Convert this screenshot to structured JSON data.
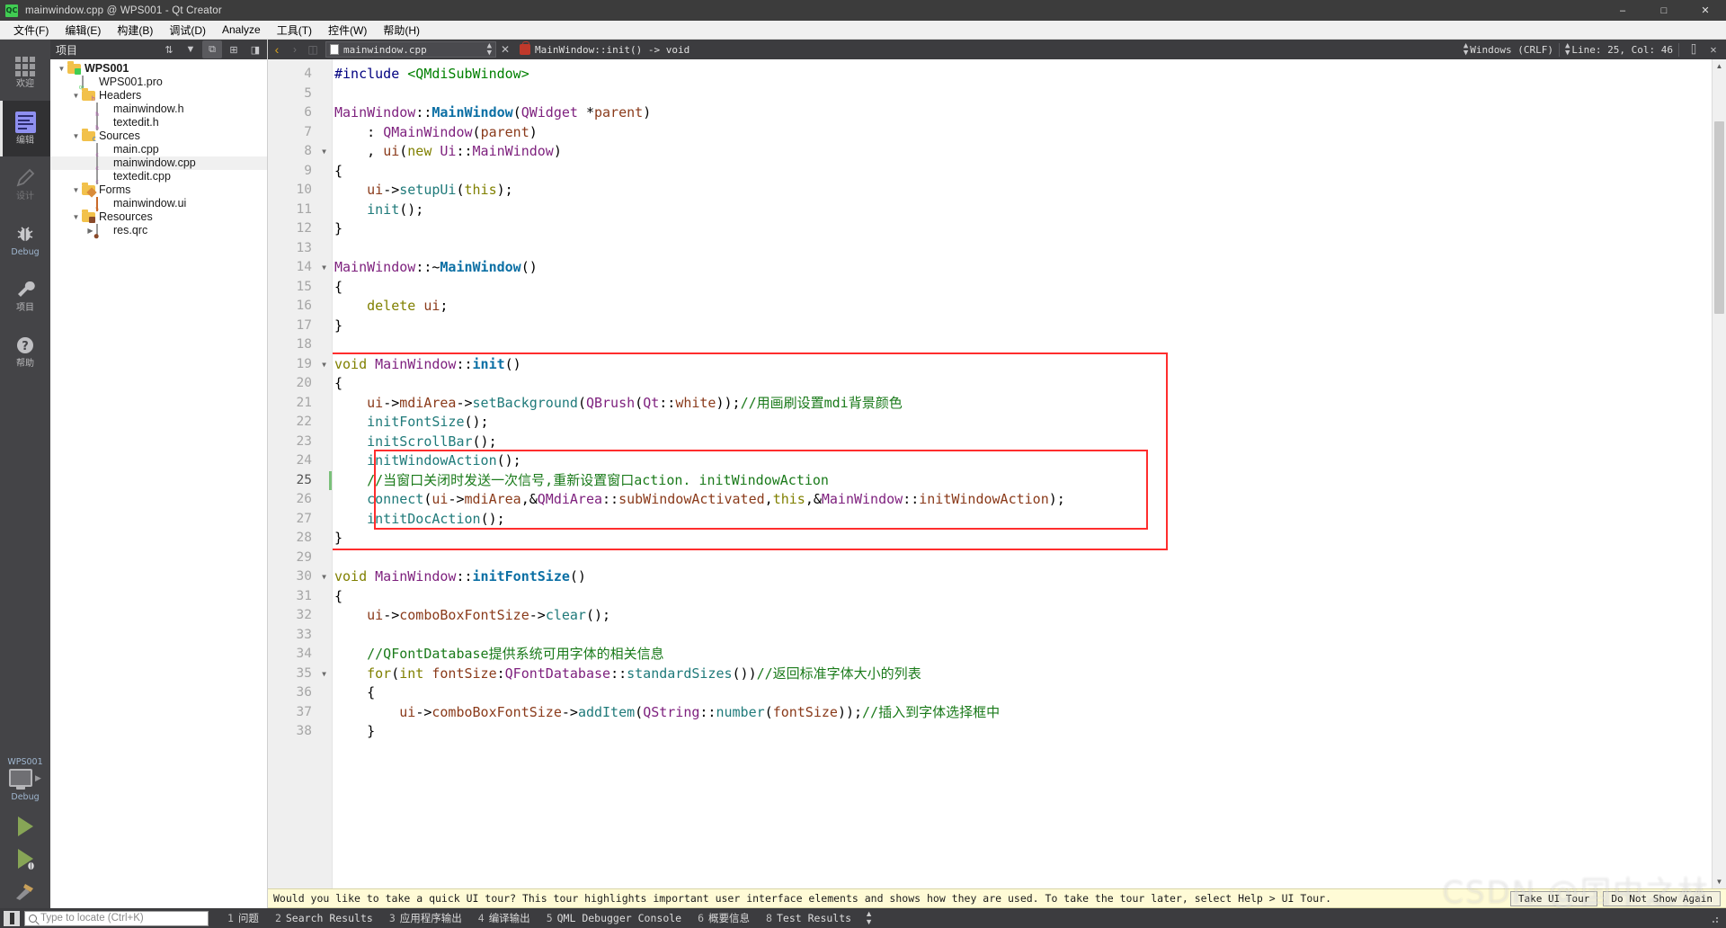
{
  "window": {
    "title": "mainwindow.cpp @ WPS001 - Qt Creator",
    "logo": "qt-creator-logo",
    "minimize": "–",
    "maximize": "□",
    "close": "✕"
  },
  "menubar": {
    "items": [
      {
        "label": "文件(F)",
        "name": "menu-file"
      },
      {
        "label": "编辑(E)",
        "name": "menu-edit"
      },
      {
        "label": "构建(B)",
        "name": "menu-build"
      },
      {
        "label": "调试(D)",
        "name": "menu-debug"
      },
      {
        "label": "Analyze",
        "name": "menu-analyze"
      },
      {
        "label": "工具(T)",
        "name": "menu-tools"
      },
      {
        "label": "控件(W)",
        "name": "menu-window"
      },
      {
        "label": "帮助(H)",
        "name": "menu-help"
      }
    ]
  },
  "activitybar": {
    "modes": [
      {
        "label": "欢迎",
        "icon": "grid-icon",
        "active": false,
        "dim": false
      },
      {
        "label": "编辑",
        "icon": "edit-icon",
        "active": true,
        "dim": false
      },
      {
        "label": "设计",
        "icon": "pencil-icon",
        "active": false,
        "dim": true
      },
      {
        "label": "Debug",
        "icon": "bug-icon",
        "active": false,
        "dim": false
      },
      {
        "label": "项目",
        "icon": "wrench-icon",
        "active": false,
        "dim": false
      },
      {
        "label": "帮助",
        "icon": "question-icon",
        "active": false,
        "dim": false
      }
    ],
    "kit": {
      "project": "WPS001",
      "build_config": "Debug",
      "run_label": "run-button",
      "debug_label": "run-debug-button",
      "build_label": "build-button"
    }
  },
  "project_panel": {
    "title": "项目",
    "toolbar": [
      {
        "name": "sort-toggle-button",
        "glyph": "⇅"
      },
      {
        "name": "filter-button",
        "glyph": "▼"
      },
      {
        "name": "sync-with-editor-button",
        "glyph": "⧉"
      },
      {
        "name": "expand-all-button",
        "glyph": "⊞"
      },
      {
        "name": "hide-sidebar-button",
        "glyph": "◨"
      }
    ],
    "tree": [
      {
        "label": "WPS001",
        "indent": 0,
        "twist": "▼",
        "icon": "project-folder-icon",
        "bold": true,
        "selected": false
      },
      {
        "label": "WPS001.pro",
        "indent": 1,
        "twist": "",
        "icon": "pro-file-icon",
        "bold": false,
        "selected": false
      },
      {
        "label": "Headers",
        "indent": 1,
        "twist": "▼",
        "icon": "headers-folder-icon",
        "bold": false,
        "selected": false
      },
      {
        "label": "mainwindow.h",
        "indent": 2,
        "twist": "",
        "icon": "header-file-icon",
        "bold": false,
        "selected": false
      },
      {
        "label": "textedit.h",
        "indent": 2,
        "twist": "",
        "icon": "header-file-icon",
        "bold": false,
        "selected": false
      },
      {
        "label": "Sources",
        "indent": 1,
        "twist": "▼",
        "icon": "sources-folder-icon",
        "bold": false,
        "selected": false
      },
      {
        "label": "main.cpp",
        "indent": 2,
        "twist": "",
        "icon": "cpp-file-icon",
        "bold": false,
        "selected": false
      },
      {
        "label": "mainwindow.cpp",
        "indent": 2,
        "twist": "",
        "icon": "cpp-file-icon",
        "bold": false,
        "selected": true
      },
      {
        "label": "textedit.cpp",
        "indent": 2,
        "twist": "",
        "icon": "cpp-file-icon",
        "bold": false,
        "selected": false
      },
      {
        "label": "Forms",
        "indent": 1,
        "twist": "▼",
        "icon": "forms-folder-icon",
        "bold": false,
        "selected": false
      },
      {
        "label": "mainwindow.ui",
        "indent": 2,
        "twist": "",
        "icon": "ui-file-icon",
        "bold": false,
        "selected": false
      },
      {
        "label": "Resources",
        "indent": 1,
        "twist": "▼",
        "icon": "resources-folder-icon",
        "bold": false,
        "selected": false
      },
      {
        "label": "res.qrc",
        "indent": 2,
        "twist": "▶",
        "icon": "qrc-file-icon",
        "bold": false,
        "selected": false
      }
    ]
  },
  "editor": {
    "toolbar": {
      "back": "‹",
      "forward": "›",
      "split": "◫",
      "file_combo": "mainwindow.cpp",
      "close_button": "✕",
      "symbol_combo": "MainWindow::init() -> void",
      "line_ending": "Windows (CRLF)",
      "cursor_position": "Line: 25, Col: 46",
      "split_button": "⌷",
      "close_split_button": "✕"
    },
    "first_line_number": 4,
    "lines": [
      {
        "n": 4,
        "fold": "",
        "tokens": [
          [
            "pp",
            "#include "
          ],
          [
            "inc",
            "<QMdiSubWindow>"
          ]
        ]
      },
      {
        "n": 5,
        "fold": "",
        "tokens": []
      },
      {
        "n": 6,
        "fold": "",
        "tokens": [
          [
            "typ",
            "MainWindow"
          ],
          [
            "pn",
            "::"
          ],
          [
            "fn",
            "MainWindow"
          ],
          [
            "pn",
            "("
          ],
          [
            "typ",
            "QWidget "
          ],
          [
            "pn",
            "*"
          ],
          [
            "loc",
            "parent"
          ],
          [
            "pn",
            ")"
          ]
        ]
      },
      {
        "n": 7,
        "fold": "",
        "tokens": [
          [
            "pn",
            "    : "
          ],
          [
            "typ",
            "QMainWindow"
          ],
          [
            "pn",
            "("
          ],
          [
            "loc",
            "parent"
          ],
          [
            "pn",
            ")"
          ]
        ]
      },
      {
        "n": 8,
        "fold": "▼",
        "tokens": [
          [
            "pn",
            "    , "
          ],
          [
            "loc",
            "ui"
          ],
          [
            "pn",
            "("
          ],
          [
            "k",
            "new "
          ],
          [
            "typ",
            "Ui"
          ],
          [
            "pn",
            "::"
          ],
          [
            "typ",
            "MainWindow"
          ],
          [
            "pn",
            ")"
          ]
        ]
      },
      {
        "n": 9,
        "fold": "",
        "tokens": [
          [
            "pn",
            "{"
          ]
        ]
      },
      {
        "n": 10,
        "fold": "",
        "tokens": [
          [
            "loc",
            "    ui"
          ],
          [
            "pn",
            "->"
          ],
          [
            "call",
            "setupUi"
          ],
          [
            "pn",
            "("
          ],
          [
            "k",
            "this"
          ],
          [
            "pn",
            ");"
          ]
        ]
      },
      {
        "n": 11,
        "fold": "",
        "tokens": [
          [
            "call",
            "    init"
          ],
          [
            "pn",
            "();"
          ]
        ]
      },
      {
        "n": 12,
        "fold": "",
        "tokens": [
          [
            "pn",
            "}"
          ]
        ]
      },
      {
        "n": 13,
        "fold": "",
        "tokens": []
      },
      {
        "n": 14,
        "fold": "▼",
        "tokens": [
          [
            "typ",
            "MainWindow"
          ],
          [
            "pn",
            "::~"
          ],
          [
            "fn",
            "MainWindow"
          ],
          [
            "pn",
            "()"
          ]
        ]
      },
      {
        "n": 15,
        "fold": "",
        "tokens": [
          [
            "pn",
            "{"
          ]
        ]
      },
      {
        "n": 16,
        "fold": "",
        "tokens": [
          [
            "k",
            "    delete "
          ],
          [
            "loc",
            "ui"
          ],
          [
            "pn",
            ";"
          ]
        ]
      },
      {
        "n": 17,
        "fold": "",
        "tokens": [
          [
            "pn",
            "}"
          ]
        ]
      },
      {
        "n": 18,
        "fold": "",
        "tokens": []
      },
      {
        "n": 19,
        "fold": "▼",
        "tokens": [
          [
            "k",
            "void "
          ],
          [
            "typ",
            "MainWindow"
          ],
          [
            "pn",
            "::"
          ],
          [
            "fn",
            "init"
          ],
          [
            "pn",
            "()"
          ]
        ]
      },
      {
        "n": 20,
        "fold": "",
        "tokens": [
          [
            "pn",
            "{"
          ]
        ]
      },
      {
        "n": 21,
        "fold": "",
        "tokens": [
          [
            "loc",
            "    ui"
          ],
          [
            "pn",
            "->"
          ],
          [
            "loc",
            "mdiArea"
          ],
          [
            "pn",
            "->"
          ],
          [
            "call",
            "setBackground"
          ],
          [
            "pn",
            "("
          ],
          [
            "typ",
            "QBrush"
          ],
          [
            "pn",
            "("
          ],
          [
            "typ",
            "Qt"
          ],
          [
            "pn",
            "::"
          ],
          [
            "loc",
            "white"
          ],
          [
            "pn",
            "));"
          ],
          [
            "cm",
            "//用画刷设置mdi背景颜色"
          ]
        ]
      },
      {
        "n": 22,
        "fold": "",
        "tokens": [
          [
            "call",
            "    initFontSize"
          ],
          [
            "pn",
            "();"
          ]
        ]
      },
      {
        "n": 23,
        "fold": "",
        "tokens": [
          [
            "call",
            "    initScrollBar"
          ],
          [
            "pn",
            "();"
          ]
        ]
      },
      {
        "n": 24,
        "fold": "",
        "tokens": [
          [
            "call",
            "    initWindowAction"
          ],
          [
            "pn",
            "();"
          ]
        ]
      },
      {
        "n": 25,
        "fold": "",
        "tokens": [
          [
            "cm",
            "    //当窗口关闭时发送一次信号,重新设置窗口action. initWindowAction"
          ]
        ]
      },
      {
        "n": 26,
        "fold": "",
        "tokens": [
          [
            "call",
            "    connect"
          ],
          [
            "pn",
            "("
          ],
          [
            "loc",
            "ui"
          ],
          [
            "pn",
            "->"
          ],
          [
            "loc",
            "mdiArea"
          ],
          [
            "pn",
            ",&"
          ],
          [
            "typ",
            "QMdiArea"
          ],
          [
            "pn",
            "::"
          ],
          [
            "loc",
            "subWindowActivated"
          ],
          [
            "pn",
            ","
          ],
          [
            "k",
            "this"
          ],
          [
            "pn",
            ",&"
          ],
          [
            "typ",
            "MainWindow"
          ],
          [
            "pn",
            "::"
          ],
          [
            "loc",
            "initWindowAction"
          ],
          [
            "pn",
            ");"
          ]
        ]
      },
      {
        "n": 27,
        "fold": "",
        "tokens": [
          [
            "call",
            "    intitDocAction"
          ],
          [
            "pn",
            "();"
          ]
        ]
      },
      {
        "n": 28,
        "fold": "",
        "tokens": [
          [
            "pn",
            "}"
          ]
        ]
      },
      {
        "n": 29,
        "fold": "",
        "tokens": []
      },
      {
        "n": 30,
        "fold": "▼",
        "tokens": [
          [
            "k",
            "void "
          ],
          [
            "typ",
            "MainWindow"
          ],
          [
            "pn",
            "::"
          ],
          [
            "fn",
            "initFontSize"
          ],
          [
            "pn",
            "()"
          ]
        ]
      },
      {
        "n": 31,
        "fold": "",
        "tokens": [
          [
            "pn",
            "{"
          ]
        ]
      },
      {
        "n": 32,
        "fold": "",
        "tokens": [
          [
            "loc",
            "    ui"
          ],
          [
            "pn",
            "->"
          ],
          [
            "loc",
            "comboBoxFontSize"
          ],
          [
            "pn",
            "->"
          ],
          [
            "call",
            "clear"
          ],
          [
            "pn",
            "();"
          ]
        ]
      },
      {
        "n": 33,
        "fold": "",
        "tokens": []
      },
      {
        "n": 34,
        "fold": "",
        "tokens": [
          [
            "cm",
            "    //QFontDatabase提供系统可用字体的相关信息"
          ]
        ]
      },
      {
        "n": 35,
        "fold": "▼",
        "tokens": [
          [
            "k",
            "    for"
          ],
          [
            "pn",
            "("
          ],
          [
            "k",
            "int "
          ],
          [
            "loc",
            "fontSize"
          ],
          [
            "pn",
            ":"
          ],
          [
            "typ",
            "QFontDatabase"
          ],
          [
            "pn",
            "::"
          ],
          [
            "call",
            "standardSizes"
          ],
          [
            "pn",
            "())"
          ],
          [
            "cm",
            "//返回标准字体大小的列表"
          ]
        ]
      },
      {
        "n": 36,
        "fold": "",
        "tokens": [
          [
            "pn",
            "    {"
          ]
        ]
      },
      {
        "n": 37,
        "fold": "",
        "tokens": [
          [
            "loc",
            "        ui"
          ],
          [
            "pn",
            "->"
          ],
          [
            "loc",
            "comboBoxFontSize"
          ],
          [
            "pn",
            "->"
          ],
          [
            "call",
            "addItem"
          ],
          [
            "pn",
            "("
          ],
          [
            "typ",
            "QString"
          ],
          [
            "pn",
            "::"
          ],
          [
            "call",
            "number"
          ],
          [
            "pn",
            "("
          ],
          [
            "loc",
            "fontSize"
          ],
          [
            "pn",
            "));"
          ],
          [
            "cm",
            "//插入到字体选择框中"
          ]
        ]
      },
      {
        "n": 38,
        "fold": "",
        "tokens": [
          [
            "pn",
            "    }"
          ]
        ]
      }
    ],
    "current_line": 25,
    "annotations": [
      {
        "name": "outer-highlight-box",
        "color": "#ff2d2d"
      },
      {
        "name": "inner-highlight-box",
        "color": "#ff2d2d"
      }
    ]
  },
  "tour_banner": {
    "message": "Would you like to take a quick UI tour? This tour highlights important user interface elements and shows how they are used. To take the tour later, select Help > UI Tour.",
    "take_tour": "Take UI Tour",
    "dismiss": "Do Not Show Again"
  },
  "statusbar": {
    "sidebar_toggle": "sidebar-toggle",
    "locator_placeholder": "Type to locate (Ctrl+K)",
    "panes": [
      {
        "num": "1",
        "label": "问题"
      },
      {
        "num": "2",
        "label": "Search Results"
      },
      {
        "num": "3",
        "label": "应用程序输出"
      },
      {
        "num": "4",
        "label": "编译输出"
      },
      {
        "num": "5",
        "label": "QML Debugger Console"
      },
      {
        "num": "6",
        "label": "概要信息"
      },
      {
        "num": "8",
        "label": "Test Results"
      }
    ]
  },
  "watermark": {
    "text": "CSDN @国中之林"
  },
  "colors": {
    "accent_red": "#ff2d2d",
    "chrome_dark": "#3c3c3f",
    "activitybar": "#444447",
    "banner_yellow": "#fffbd6",
    "selection_gray": "#f0f0f0"
  }
}
